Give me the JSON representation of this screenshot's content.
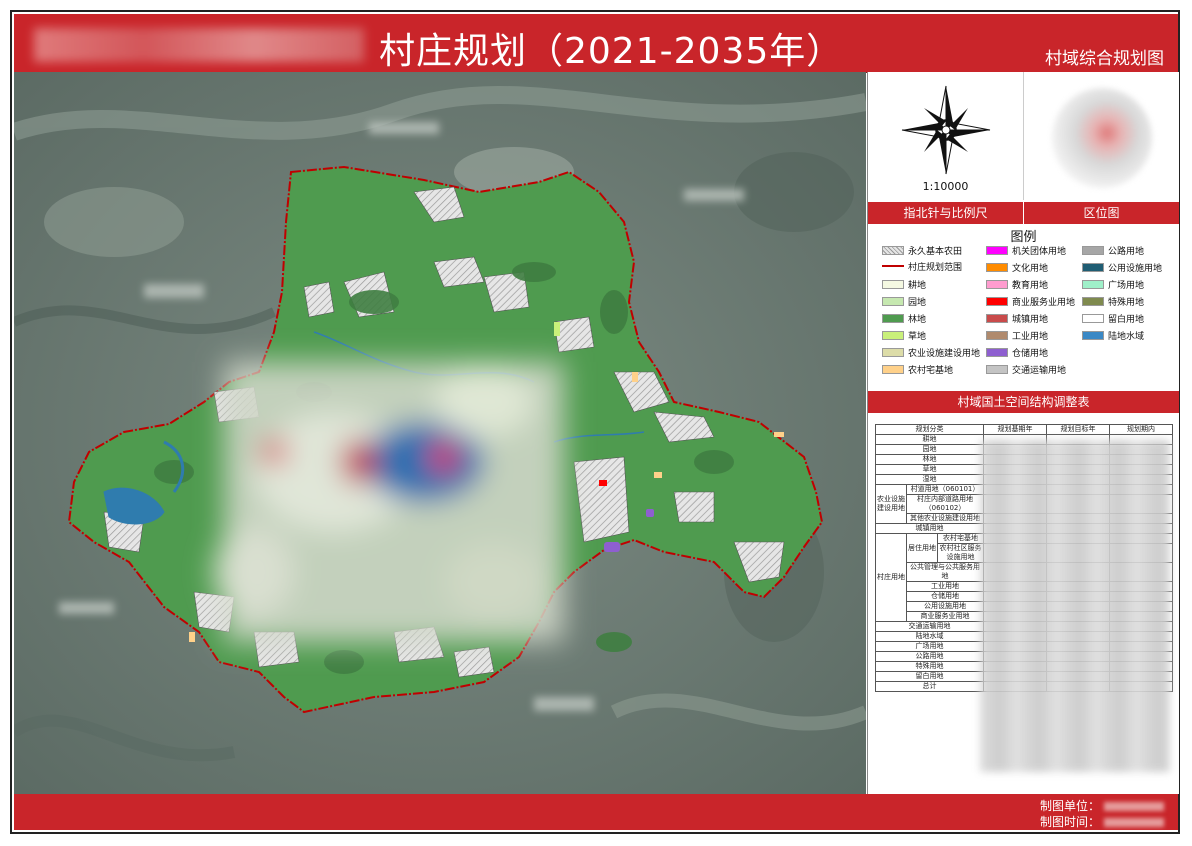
{
  "header": {
    "title": "村庄规划（2021-2035年）",
    "subtitle": "村域综合规划图"
  },
  "compass": {
    "scale": "1:10000",
    "label": "指北针与比例尺"
  },
  "location": {
    "label": "区位图"
  },
  "legend": {
    "title": "图例",
    "items": [
      {
        "label": "永久基本农田",
        "color": "#d9d9d9"
      },
      {
        "label": "机关团体用地",
        "color": "#ff00ff"
      },
      {
        "label": "公路用地",
        "color": "#a6a6a6"
      },
      {
        "label": "村庄规划范围",
        "color": "#c00000"
      },
      {
        "label": "文化用地",
        "color": "#ff8c00"
      },
      {
        "label": "公用设施用地",
        "color": "#1f5d73"
      },
      {
        "label": "耕地",
        "color": "#f5f9e2"
      },
      {
        "label": "教育用地",
        "color": "#ff9ccf"
      },
      {
        "label": "广场用地",
        "color": "#9ff0c9"
      },
      {
        "label": "园地",
        "color": "#c6e8b0"
      },
      {
        "label": "商业服务业用地",
        "color": "#ff0000"
      },
      {
        "label": "特殊用地",
        "color": "#7f8a4e"
      },
      {
        "label": "林地",
        "color": "#4f9b4f"
      },
      {
        "label": "城镇用地",
        "color": "#c94b4b"
      },
      {
        "label": "留白用地",
        "color": "#ffffff"
      },
      {
        "label": "草地",
        "color": "#c9f07a"
      },
      {
        "label": "工业用地",
        "color": "#b08a6d"
      },
      {
        "label": "陆地水域",
        "color": "#3a88c5"
      },
      {
        "label": "农业设施建设用地",
        "color": "#dcdca8"
      },
      {
        "label": "仓储用地",
        "color": "#8e5fd0"
      },
      {
        "label": "",
        "color": ""
      },
      {
        "label": "农村宅基地",
        "color": "#ffd18a"
      },
      {
        "label": "交通运输用地",
        "color": "#c4c4c4"
      }
    ]
  },
  "table": {
    "title": "村域国土空间结构调整表",
    "col_headers": [
      "规划分类",
      "规划基期年",
      "规划目标年",
      "规划期内"
    ],
    "rows": [
      {
        "group": "",
        "sub": "",
        "name": "耕地"
      },
      {
        "group": "",
        "sub": "",
        "name": "园地"
      },
      {
        "group": "",
        "sub": "",
        "name": "林地"
      },
      {
        "group": "",
        "sub": "",
        "name": "草地"
      },
      {
        "group": "",
        "sub": "",
        "name": "湿地"
      },
      {
        "group": "农业设施建设用地",
        "sub": "",
        "name": "村道用地（060101）"
      },
      {
        "group": "",
        "sub": "",
        "name": "村庄内部道路用地（060102）"
      },
      {
        "group": "",
        "sub": "",
        "name": "其他农业设施建设用地"
      },
      {
        "group": "",
        "sub": "",
        "name": "城镇用地"
      },
      {
        "group": "村庄用地",
        "sub": "居住用地",
        "name": "农村宅基地"
      },
      {
        "group": "",
        "sub": "",
        "name": "农村社区服务设施用地"
      },
      {
        "group": "",
        "sub": "",
        "name": "公共管理与公共服务用地"
      },
      {
        "group": "",
        "sub": "",
        "name": "工业用地"
      },
      {
        "group": "",
        "sub": "",
        "name": "仓储用地"
      },
      {
        "group": "",
        "sub": "",
        "name": "公用设施用地"
      },
      {
        "group": "",
        "sub": "",
        "name": "商业服务业用地"
      },
      {
        "group": "",
        "sub": "",
        "name": "交通运输用地"
      },
      {
        "group": "",
        "sub": "",
        "name": "陆地水域"
      },
      {
        "group": "",
        "sub": "",
        "name": "广场用地"
      },
      {
        "group": "",
        "sub": "",
        "name": "公路用地"
      },
      {
        "group": "",
        "sub": "",
        "name": "特殊用地"
      },
      {
        "group": "",
        "sub": "",
        "name": "留白用地"
      },
      {
        "group": "",
        "sub": "",
        "name": "总计"
      }
    ]
  },
  "footer": {
    "unit_label": "制图单位：",
    "time_label": "制图时间："
  },
  "colors": {
    "brand_red": "#c9252a",
    "forest_green": "#4f9b4f",
    "boundary": "#c00000"
  }
}
